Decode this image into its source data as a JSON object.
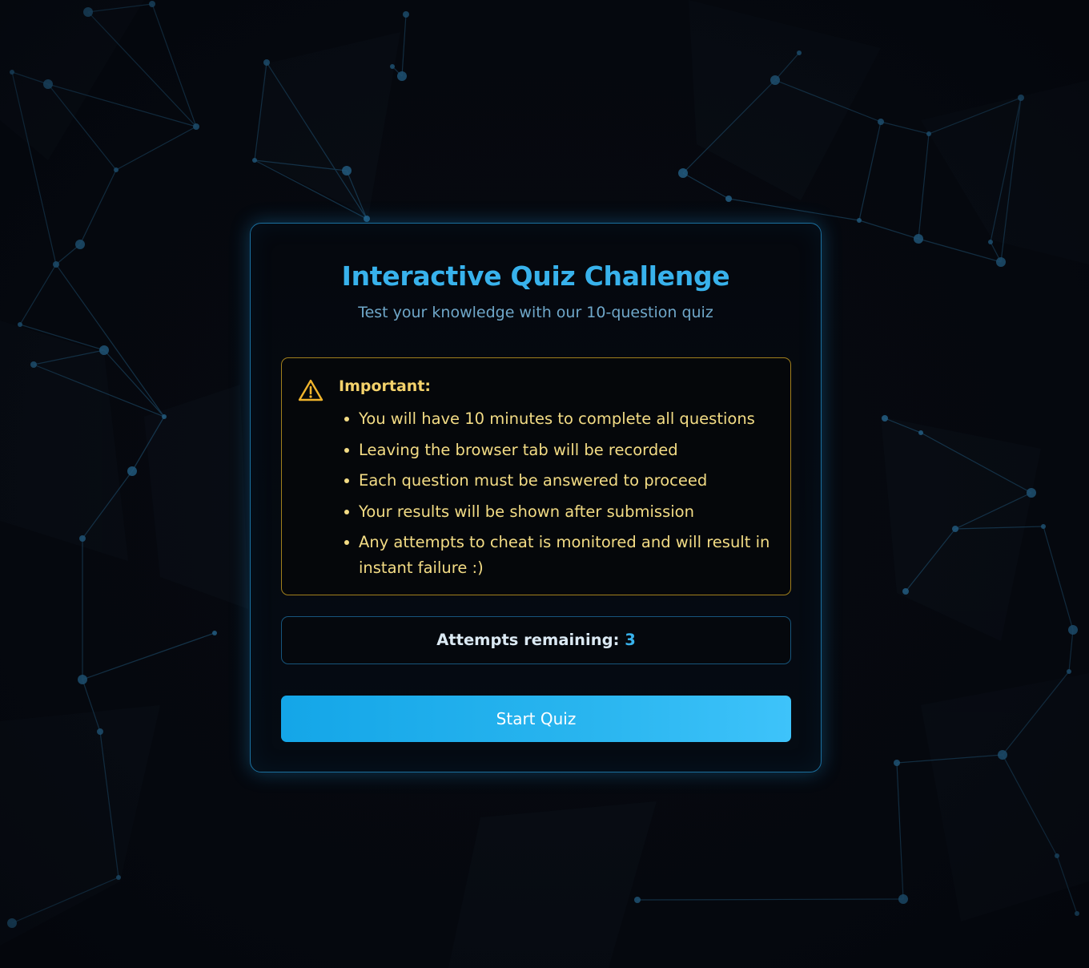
{
  "colors": {
    "accent": "#38b2ec",
    "warning": "#f4d26b",
    "background": "#06090f",
    "network": "#2a6f9a"
  },
  "quiz": {
    "title": "Interactive Quiz Challenge",
    "subtitle": "Test your knowledge with our 10-question quiz"
  },
  "notice": {
    "icon": "warning-triangle-icon",
    "heading": "Important:",
    "rules": [
      "You will have 10 minutes to complete all questions",
      "Leaving the browser tab will be recorded",
      "Each question must be answered to proceed",
      "Your results will be shown after submission",
      "Any attempts to cheat is monitored and will result in instant failure :)"
    ]
  },
  "attempts": {
    "label": "Attempts remaining:",
    "count": "3"
  },
  "actions": {
    "start_label": "Start Quiz"
  }
}
